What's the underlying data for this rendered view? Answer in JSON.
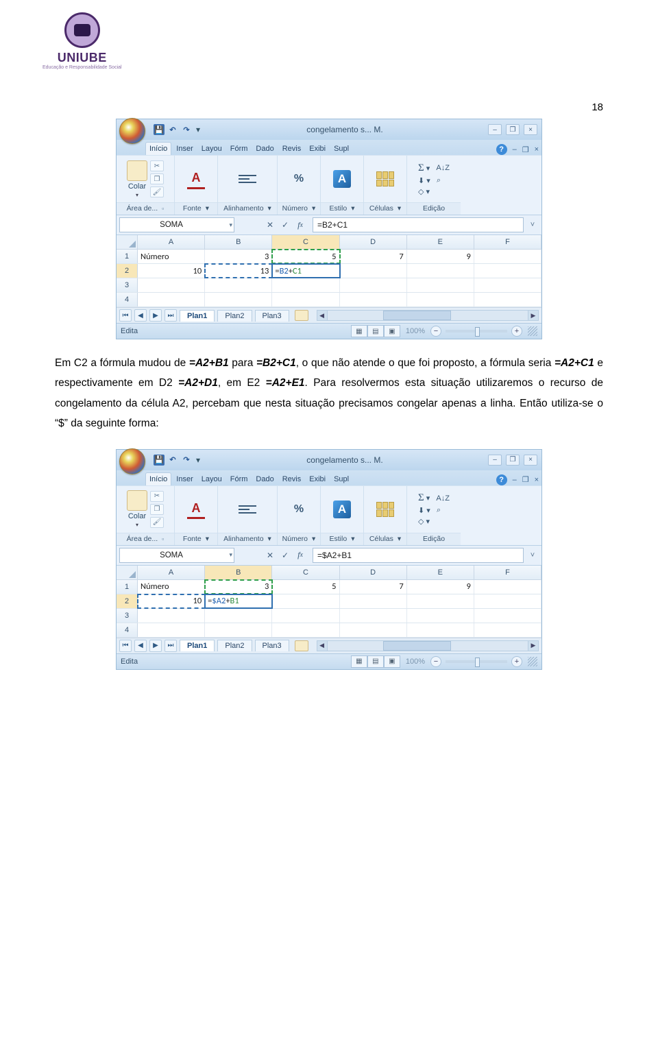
{
  "logo": {
    "name": "UNIUBE",
    "sub": "Educação e Responsabilidade Social"
  },
  "page_number": "18",
  "excel": {
    "title": "congelamento s...  M.",
    "qat": {
      "save": "save-icon",
      "undo": "↶",
      "redo": "↷"
    },
    "win": {
      "min": "–",
      "max": "❐",
      "close": "×"
    },
    "tabs": {
      "items": [
        "Iníci​o",
        "Inser",
        "Layo​u",
        "Fórm",
        "Dad​o",
        "Revis",
        "Exibi",
        "Supl"
      ],
      "active": 0,
      "help": "?"
    },
    "docwin": {
      "min": "–",
      "max": "❐",
      "close": "×"
    },
    "ribbon": {
      "clipboard": {
        "label": "Área de...",
        "btn": "Colar"
      },
      "font": {
        "label": "Fonte"
      },
      "align": {
        "label": "Alinhamento"
      },
      "number": {
        "label": "Número",
        "pct": "%"
      },
      "style": {
        "label": "Estilo"
      },
      "cells": {
        "label": "Células"
      },
      "editing": {
        "label": "Edição",
        "sigma": "Σ",
        "sort": "A↓Z",
        "fill": "⬇",
        "find": "⌕",
        "clear": "◇"
      }
    },
    "status": {
      "mode": "Edita",
      "zoom": "100%"
    }
  },
  "shot1": {
    "namebox": "SOMA",
    "formula": "=B2+C1",
    "cols": [
      "A",
      "B",
      "C",
      "D",
      "E",
      "F"
    ],
    "selCol": "C",
    "selRow": "2",
    "grid": [
      {
        "r": "1",
        "cells": [
          {
            "v": "Número",
            "align": "left"
          },
          {
            "v": "3"
          },
          {
            "v": "5",
            "ref": "green"
          },
          {
            "v": "7"
          },
          {
            "v": "9"
          },
          {
            "v": ""
          }
        ]
      },
      {
        "r": "2",
        "cells": [
          {
            "v": "10"
          },
          {
            "v": "13",
            "ref": "blue"
          },
          {
            "v": "=B2+C1",
            "edit": true,
            "align": "left",
            "rich": true
          },
          {
            "v": ""
          },
          {
            "v": ""
          },
          {
            "v": ""
          }
        ]
      },
      {
        "r": "3",
        "cells": [
          {
            "v": ""
          },
          {
            "v": ""
          },
          {
            "v": ""
          },
          {
            "v": ""
          },
          {
            "v": ""
          },
          {
            "v": ""
          }
        ]
      },
      {
        "r": "4",
        "cells": [
          {
            "v": ""
          },
          {
            "v": ""
          },
          {
            "v": ""
          },
          {
            "v": ""
          },
          {
            "v": ""
          },
          {
            "v": ""
          }
        ]
      }
    ],
    "sheets": [
      "Plan1",
      "Plan2",
      "Plan3"
    ],
    "activeSheet": 0
  },
  "para": {
    "t1a": "Em C2 a fórmula mudou de ",
    "f1": "=A2+B1",
    "t1b": " para ",
    "f2": "=B2+C1",
    "t1c": ", o que não atende o que foi proposto, a fórmula seria ",
    "f3": "=A2+C1",
    "t1d": " e respectivamente em D2 ",
    "f4": "=A2+D1",
    "t1e": ", em E2 ",
    "f5": "=A2+E1",
    "t1f": ".",
    "t2": "Para resolvermos esta situação utilizaremos o recurso de congelamento da célula A2, percebam que nesta situação precisamos congelar apenas a linha. Então utiliza-se o “$” da seguinte forma:"
  },
  "shot2": {
    "namebox": "SOMA",
    "formula": "=$A2+B1",
    "cols": [
      "A",
      "B",
      "C",
      "D",
      "E",
      "F"
    ],
    "selCol": "B",
    "selRow": "2",
    "grid": [
      {
        "r": "1",
        "cells": [
          {
            "v": "Número",
            "align": "left"
          },
          {
            "v": "3",
            "ref": "green"
          },
          {
            "v": "5"
          },
          {
            "v": "7"
          },
          {
            "v": "9"
          },
          {
            "v": ""
          }
        ]
      },
      {
        "r": "2",
        "cells": [
          {
            "v": "10",
            "ref": "blue"
          },
          {
            "v": "=$A2+B1",
            "edit": true,
            "align": "left",
            "rich": true
          },
          {
            "v": ""
          },
          {
            "v": ""
          },
          {
            "v": ""
          },
          {
            "v": ""
          }
        ]
      },
      {
        "r": "3",
        "cells": [
          {
            "v": ""
          },
          {
            "v": ""
          },
          {
            "v": ""
          },
          {
            "v": ""
          },
          {
            "v": ""
          },
          {
            "v": ""
          }
        ]
      },
      {
        "r": "4",
        "cells": [
          {
            "v": ""
          },
          {
            "v": ""
          },
          {
            "v": ""
          },
          {
            "v": ""
          },
          {
            "v": ""
          },
          {
            "v": ""
          }
        ]
      }
    ],
    "sheets": [
      "Plan1",
      "Plan2",
      "Plan3"
    ],
    "activeSheet": 0
  }
}
